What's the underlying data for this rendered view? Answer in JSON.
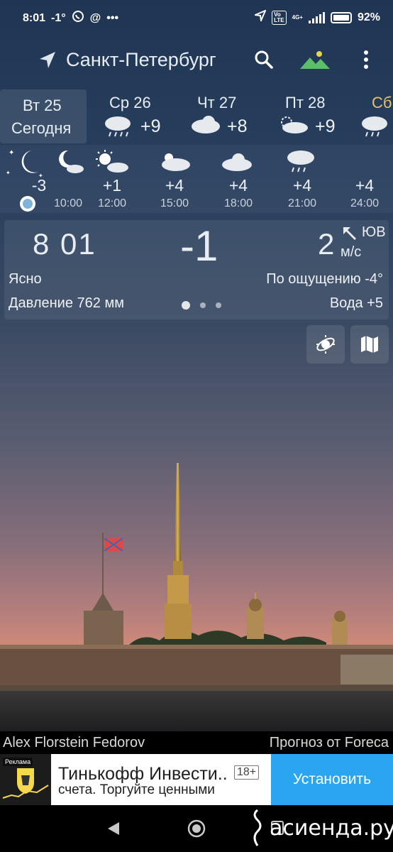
{
  "status_bar": {
    "time": "8:01",
    "temp": "-1°",
    "app_icons": [
      "whatsapp-icon",
      "at-icon",
      "more-notifications-icon"
    ],
    "volte": "Vo LTE",
    "network": "4G+",
    "battery": "92%"
  },
  "header": {
    "city": "Санкт-Петербург",
    "icons": [
      "location-arrow-icon",
      "search-icon",
      "landscape-icon",
      "more-vert-icon"
    ]
  },
  "days": [
    {
      "name": "Вт 25",
      "sub": "Сегодня",
      "temp": "",
      "icon": "night-moon-icon"
    },
    {
      "name": "Ср 26",
      "temp": "+9",
      "icon": "rain-cloud-icon"
    },
    {
      "name": "Чт 27",
      "temp": "+8",
      "icon": "cloud-icon"
    },
    {
      "name": "Пт 28",
      "temp": "+9",
      "icon": "partly-cloudy-icon"
    },
    {
      "name": "Сб",
      "temp": "",
      "icon": "rain-cloud-icon",
      "accent": "#e8c26a"
    }
  ],
  "hourly": [
    {
      "temp": "-3",
      "hour": "",
      "icon": "moon-stars-icon"
    },
    {
      "temp": "",
      "hour": "10:00",
      "icon": "moon-cloud-icon"
    },
    {
      "temp": "+1",
      "hour": "12:00",
      "icon": "sun-cloud-icon"
    },
    {
      "temp": "+4",
      "hour": "15:00",
      "icon": "sun-cloud-icon"
    },
    {
      "temp": "+4",
      "hour": "18:00",
      "icon": "cloud-icon"
    },
    {
      "temp": "+4",
      "hour": "21:00",
      "icon": "rain-cloud-icon"
    },
    {
      "temp": "+4",
      "hour": "24:00",
      "icon": "cloud-icon"
    }
  ],
  "current": {
    "time": "8 01",
    "temp": "-1",
    "wind_speed": "2",
    "wind_dir": "ЮВ",
    "wind_unit": "м/с",
    "condition": "Ясно",
    "feels_like": "По ощущению -4°",
    "pressure": "Давление 762 мм",
    "water": "Вода +5",
    "page_count": 3,
    "active_page": 1
  },
  "tools": [
    "sun-orbit-icon",
    "map-icon"
  ],
  "credits": {
    "photo": "Alex Florstein Fedorov",
    "forecast": "Прогноз от Foreca"
  },
  "ad": {
    "label": "Реклама",
    "title": "Тинькофф Инвести..",
    "age": "18+",
    "description": "счета. Торгуйте ценными",
    "button": "Установить"
  },
  "watermark": "асиенда.ру",
  "colors": {
    "ad_button": "#2aa6f0",
    "accent_day": "#e8c26a",
    "sky_top": "#1f3553",
    "sky_bottom": "#cf8a78"
  }
}
